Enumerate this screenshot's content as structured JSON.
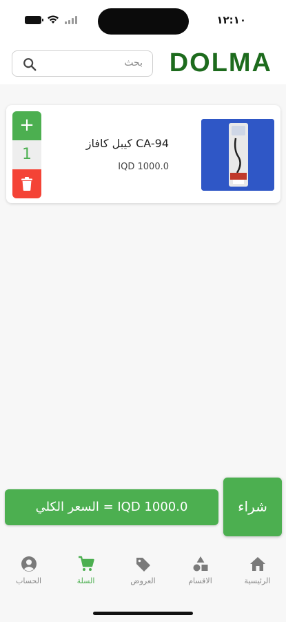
{
  "status_bar": {
    "time": "١٢:١٠"
  },
  "header": {
    "logo": "DOLMA",
    "search_placeholder": "بحث"
  },
  "cart": {
    "items": [
      {
        "name": "كيبل كافاز CA-94",
        "price": "IQD 1000.0",
        "quantity": "1",
        "plus_label": "+"
      }
    ]
  },
  "footer": {
    "total_text": "السعر الكلي  =  IQD 1000.0",
    "buy_label": "شراء"
  },
  "tabs": [
    {
      "label": "الحساب",
      "icon": "account-icon",
      "active": false
    },
    {
      "label": "السلة",
      "icon": "cart-icon",
      "active": true
    },
    {
      "label": "العروض",
      "icon": "offers-tag-icon",
      "active": false
    },
    {
      "label": "الاقسام",
      "icon": "categories-icon",
      "active": false
    },
    {
      "label": "الرئيسية",
      "icon": "home-icon",
      "active": false
    }
  ],
  "colors": {
    "accent": "#4caf50",
    "logo": "#1d6b1d",
    "danger": "#f44336",
    "inactive": "#888888"
  }
}
